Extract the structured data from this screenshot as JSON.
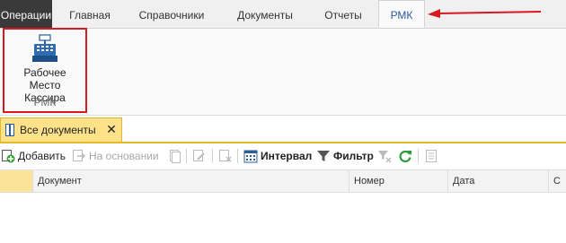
{
  "ribbon": {
    "tabs": [
      {
        "label": "Операции"
      },
      {
        "label": "Главная"
      },
      {
        "label": "Справочники"
      },
      {
        "label": "Документы"
      },
      {
        "label": "Отчеты"
      },
      {
        "label": "РМК"
      }
    ],
    "active_tab": "РМК",
    "rmk_button": {
      "line1": "Рабочее",
      "line2": "Место Кассира"
    },
    "group_label": "РМК"
  },
  "doc_tab": {
    "label": "Все документы",
    "close": "✕"
  },
  "toolbar": {
    "add": "Добавить",
    "based_on": "На основании",
    "interval": "Интервал",
    "filter": "Фильтр"
  },
  "grid": {
    "columns": [
      "Документ",
      "Номер",
      "Дата",
      "С"
    ]
  },
  "colors": {
    "annotation_red": "#d8181f",
    "active_tab_text": "#2b5a9e",
    "doc_tab_bg": "#fde28a"
  }
}
